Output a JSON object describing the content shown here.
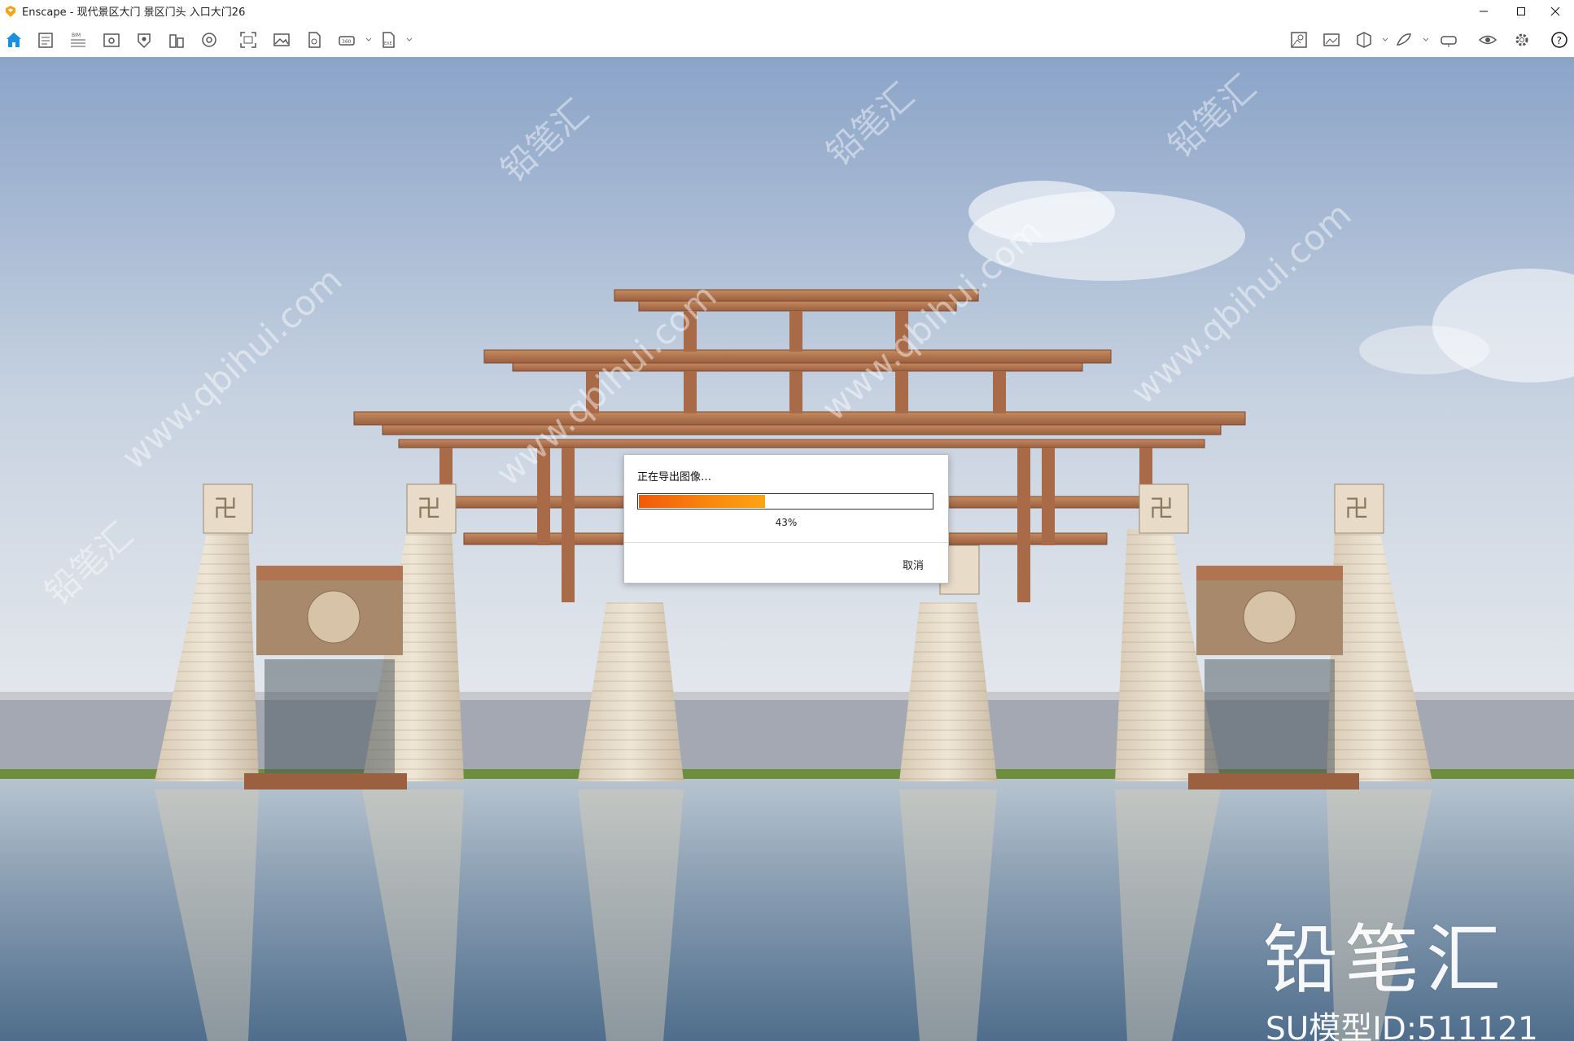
{
  "window": {
    "title": "Enscape - 现代景区大门 景区门头 入口大门26",
    "controls": [
      "minimize-icon",
      "maximize-icon",
      "close-icon"
    ]
  },
  "toolbar": {
    "left_icons": [
      "home-icon",
      "documents-icon",
      "bim-icon",
      "views-icon",
      "assets-icon",
      "building-icon",
      "atmosphere-icon",
      "screenshot-icon",
      "image-icon",
      "panorama-icon",
      "vr-icon",
      "export-exe-icon"
    ],
    "right_icons": [
      "map-icon",
      "gallery-icon",
      "cube-view-icon",
      "feedback-icon",
      "vr-headset-icon",
      "visibility-icon",
      "settings-icon",
      "help-icon"
    ],
    "collapse_icon": "chevron-up-icon"
  },
  "dialog": {
    "title": "正在导出图像…",
    "progress": 0.43,
    "progress_label": "43%",
    "cancel_label": "取消",
    "accent": "#f57212"
  },
  "watermark": {
    "brand": "铅笔汇",
    "id_text": "SU模型ID:511121",
    "pattern": [
      "铅笔汇",
      "www.qbihui.com"
    ]
  },
  "colors": {
    "sky_top": "#8ba4c8",
    "sky_bottom": "#dfe6ee",
    "timber": "#b07550",
    "stone": "#e6d9c4",
    "water": "#7c93ab"
  }
}
